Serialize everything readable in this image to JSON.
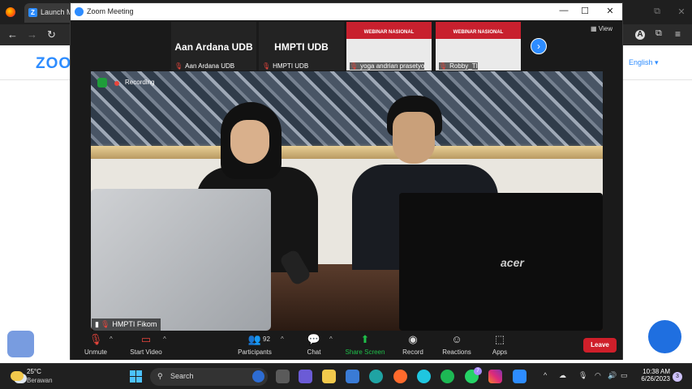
{
  "browser": {
    "tab_title": "Launch M",
    "english_label": "English",
    "zoom_logo": "ZOOM"
  },
  "zoom_window": {
    "title": "Zoom Meeting",
    "view_label": "View",
    "recording_label": "Recording",
    "thumbnails": [
      {
        "big": "Aan Ardana UDB",
        "name": "Aan Ardana UDB",
        "type": "name"
      },
      {
        "big": "HMPTI UDB",
        "name": "HMPTI UDB",
        "type": "name"
      },
      {
        "big": "WEBINAR NASIONAL",
        "name": "yoga andrian prasetyo",
        "type": "web"
      },
      {
        "big": "WEBINAR NASIONAL",
        "name": "Robby_TI",
        "type": "web"
      }
    ],
    "active_speaker": "HMPTI Fikom",
    "laptop_brand": "acer",
    "toolbar": {
      "unmute": "Unmute",
      "start_video": "Start Video",
      "participants": "Participants",
      "participants_count": "92",
      "chat": "Chat",
      "share_screen": "Share Screen",
      "record": "Record",
      "reactions": "Reactions",
      "apps": "Apps",
      "leave": "Leave"
    }
  },
  "taskbar": {
    "temperature": "25°C",
    "condition": "Berawan",
    "search_placeholder": "Search",
    "time": "10:38 AM",
    "date": "6/26/2023",
    "notification_count": "3",
    "whatsapp_badge": "7"
  }
}
